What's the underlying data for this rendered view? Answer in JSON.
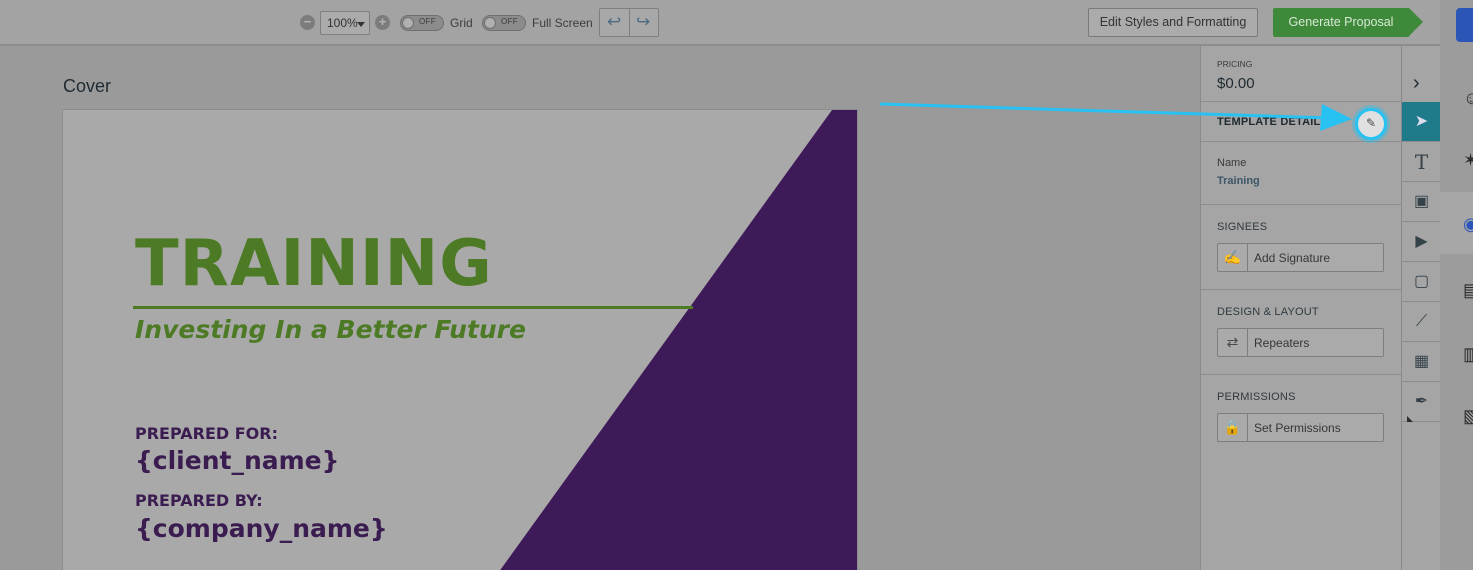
{
  "toolbar": {
    "zoom_minus": "−",
    "zoom_value": "100%",
    "zoom_plus": "+",
    "grid_toggle_state": "OFF",
    "grid_label": "Grid",
    "fullscreen_toggle_state": "OFF",
    "fullscreen_label": "Full Screen",
    "undo_glyph": "↩",
    "redo_glyph": "↪",
    "edit_styles_label": "Edit Styles and Formatting",
    "generate_label": "Generate Proposal",
    "generate_color": "#3f8a3a"
  },
  "main": {
    "section_title": "Cover",
    "cover": {
      "title": "TRAINING",
      "subtitle": "Investing In a Better Future",
      "prepared_for_label": "PREPARED FOR:",
      "client_placeholder": "{client_name}",
      "prepared_by_label": "PREPARED BY:",
      "company_placeholder": "{company_name}",
      "accent_green": "#4d7a25",
      "accent_purple": "#3f1a58"
    }
  },
  "panel": {
    "pricing_label": "PRICING",
    "pricing_value": "$0.00",
    "pricing_chevron": "›",
    "template_details_title": "TEMPLATE DETAILS",
    "edit_icon_glyph": "✎",
    "name_label": "Name",
    "name_value": "Training",
    "signees_title": "SIGNEES",
    "add_signature_label": "Add Signature",
    "signature_icon_glyph": "✍",
    "design_layout_title": "DESIGN & LAYOUT",
    "repeaters_label": "Repeaters",
    "repeaters_icon_glyph": "⇄",
    "permissions_title": "PERMISSIONS",
    "set_permissions_label": "Set Permissions",
    "lock_icon_glyph": "🔒"
  },
  "tools": {
    "icons": [
      "select-icon",
      "text-icon",
      "image-icon",
      "video-icon",
      "shape-icon",
      "line-icon",
      "table-icon",
      "signature-tool-icon"
    ],
    "glyphs": [
      "➤",
      "T",
      "▣",
      "▶",
      "▢",
      "⟋",
      "▦",
      "✒"
    ],
    "active_color": "#1f7b8a"
  },
  "app_nav": {
    "icons": [
      "contacts-icon",
      "activity-icon",
      "proposals-icon",
      "library-icon",
      "messages-icon",
      "reports-icon"
    ],
    "glyphs": [
      "☺",
      "✶",
      "◉",
      "▤",
      "▥",
      "▧"
    ],
    "logo_color": "#2c55b8"
  },
  "tutorial": {
    "arrow_color": "#27c1f2"
  }
}
